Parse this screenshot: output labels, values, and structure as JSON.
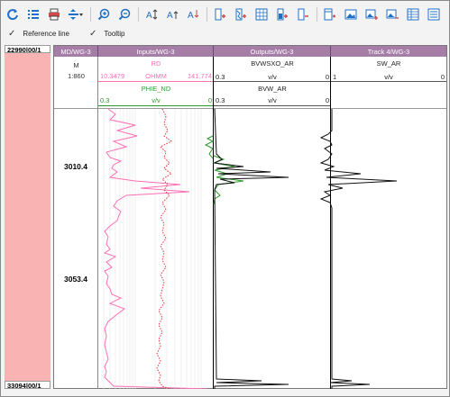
{
  "toolbar": {
    "buttons": [
      {
        "name": "refresh-icon"
      },
      {
        "name": "list-icon"
      },
      {
        "name": "print-icon"
      },
      {
        "name": "split-icon"
      },
      {
        "name": "zoom-in-icon"
      },
      {
        "name": "zoom-out-icon"
      },
      {
        "name": "text-scale-icon"
      },
      {
        "name": "text-up-icon"
      },
      {
        "name": "text-down-icon"
      },
      {
        "name": "add-track-icon"
      },
      {
        "name": "add-curve-icon"
      },
      {
        "name": "add-grid-icon"
      },
      {
        "name": "add-fill-icon"
      },
      {
        "name": "remove-icon"
      },
      {
        "name": "insert-track-icon"
      },
      {
        "name": "image-icon"
      },
      {
        "name": "image-add-icon"
      },
      {
        "name": "image-remove-icon"
      },
      {
        "name": "table-icon"
      },
      {
        "name": "settings-list-icon"
      }
    ]
  },
  "options": {
    "reference_line": "Reference line",
    "tooltip": "Tooltip"
  },
  "range": {
    "top": "22990|00/1",
    "bottom": "33094|00/1"
  },
  "tracks": {
    "md": {
      "title": "MD/WG-3",
      "unit": "M",
      "scale": "1:860"
    },
    "inputs": {
      "title": "Inputs/WG-3",
      "rd_name": "RD",
      "rd_min": "10.3479",
      "rd_unit": "OHMM",
      "rd_max": "141.774",
      "phie_name": "PHIE_ND",
      "phie_min": "0.3",
      "phie_unit": "v/v",
      "phie_max": "0"
    },
    "outputs": {
      "title": "Outputs/WG-3",
      "c1_name": "BVWSXO_AR",
      "c1_min": "0.3",
      "c1_unit": "v/v",
      "c1_max": "0",
      "c2_name": "BVW_AR",
      "c2_min": "0.3",
      "c2_unit": "v/v",
      "c2_max": "0"
    },
    "track4": {
      "title": "Track 4/WG-3",
      "c1_name": "SW_AR",
      "c1_min": "1",
      "c1_unit": "v/v",
      "c1_max": "0"
    }
  },
  "depth_labels": [
    "3010.4",
    "3053.4"
  ],
  "colors": {
    "rd_curve": "#ff6fb4",
    "phie_curve": "#e0303a",
    "output_curve2": "#2a9a2a",
    "title_bar": "#a57da7",
    "range_fill": "#f9b3b3"
  }
}
